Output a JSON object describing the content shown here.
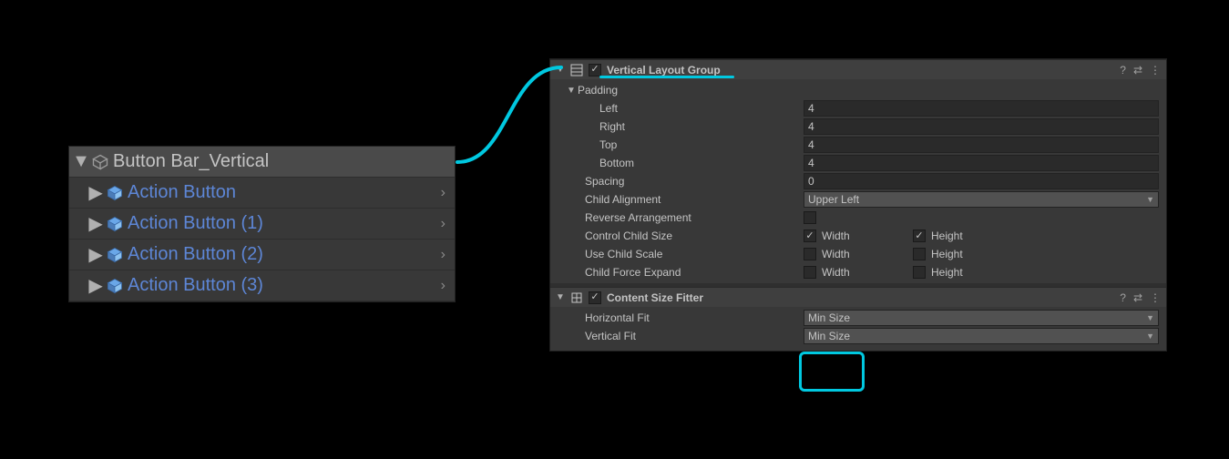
{
  "hierarchy": {
    "root": "Button Bar_Vertical",
    "children": [
      "Action Button",
      "Action Button (1)",
      "Action Button (2)",
      "Action Button (3)"
    ]
  },
  "inspector": {
    "vlg": {
      "title": "Vertical Layout Group",
      "padding_label": "Padding",
      "left_label": "Left",
      "left": "4",
      "right_label": "Right",
      "right": "4",
      "top_label": "Top",
      "top": "4",
      "bottom_label": "Bottom",
      "bottom": "4",
      "spacing_label": "Spacing",
      "spacing": "0",
      "child_align_label": "Child Alignment",
      "child_align": "Upper Left",
      "reverse_label": "Reverse Arrangement",
      "control_label": "Control Child Size",
      "usescale_label": "Use Child Scale",
      "forceexp_label": "Child Force Expand",
      "width_label": "Width",
      "height_label": "Height"
    },
    "csf": {
      "title": "Content Size Fitter",
      "hfit_label": "Horizontal Fit",
      "hfit": "Min Size",
      "vfit_label": "Vertical Fit",
      "vfit": "Min Size"
    }
  }
}
